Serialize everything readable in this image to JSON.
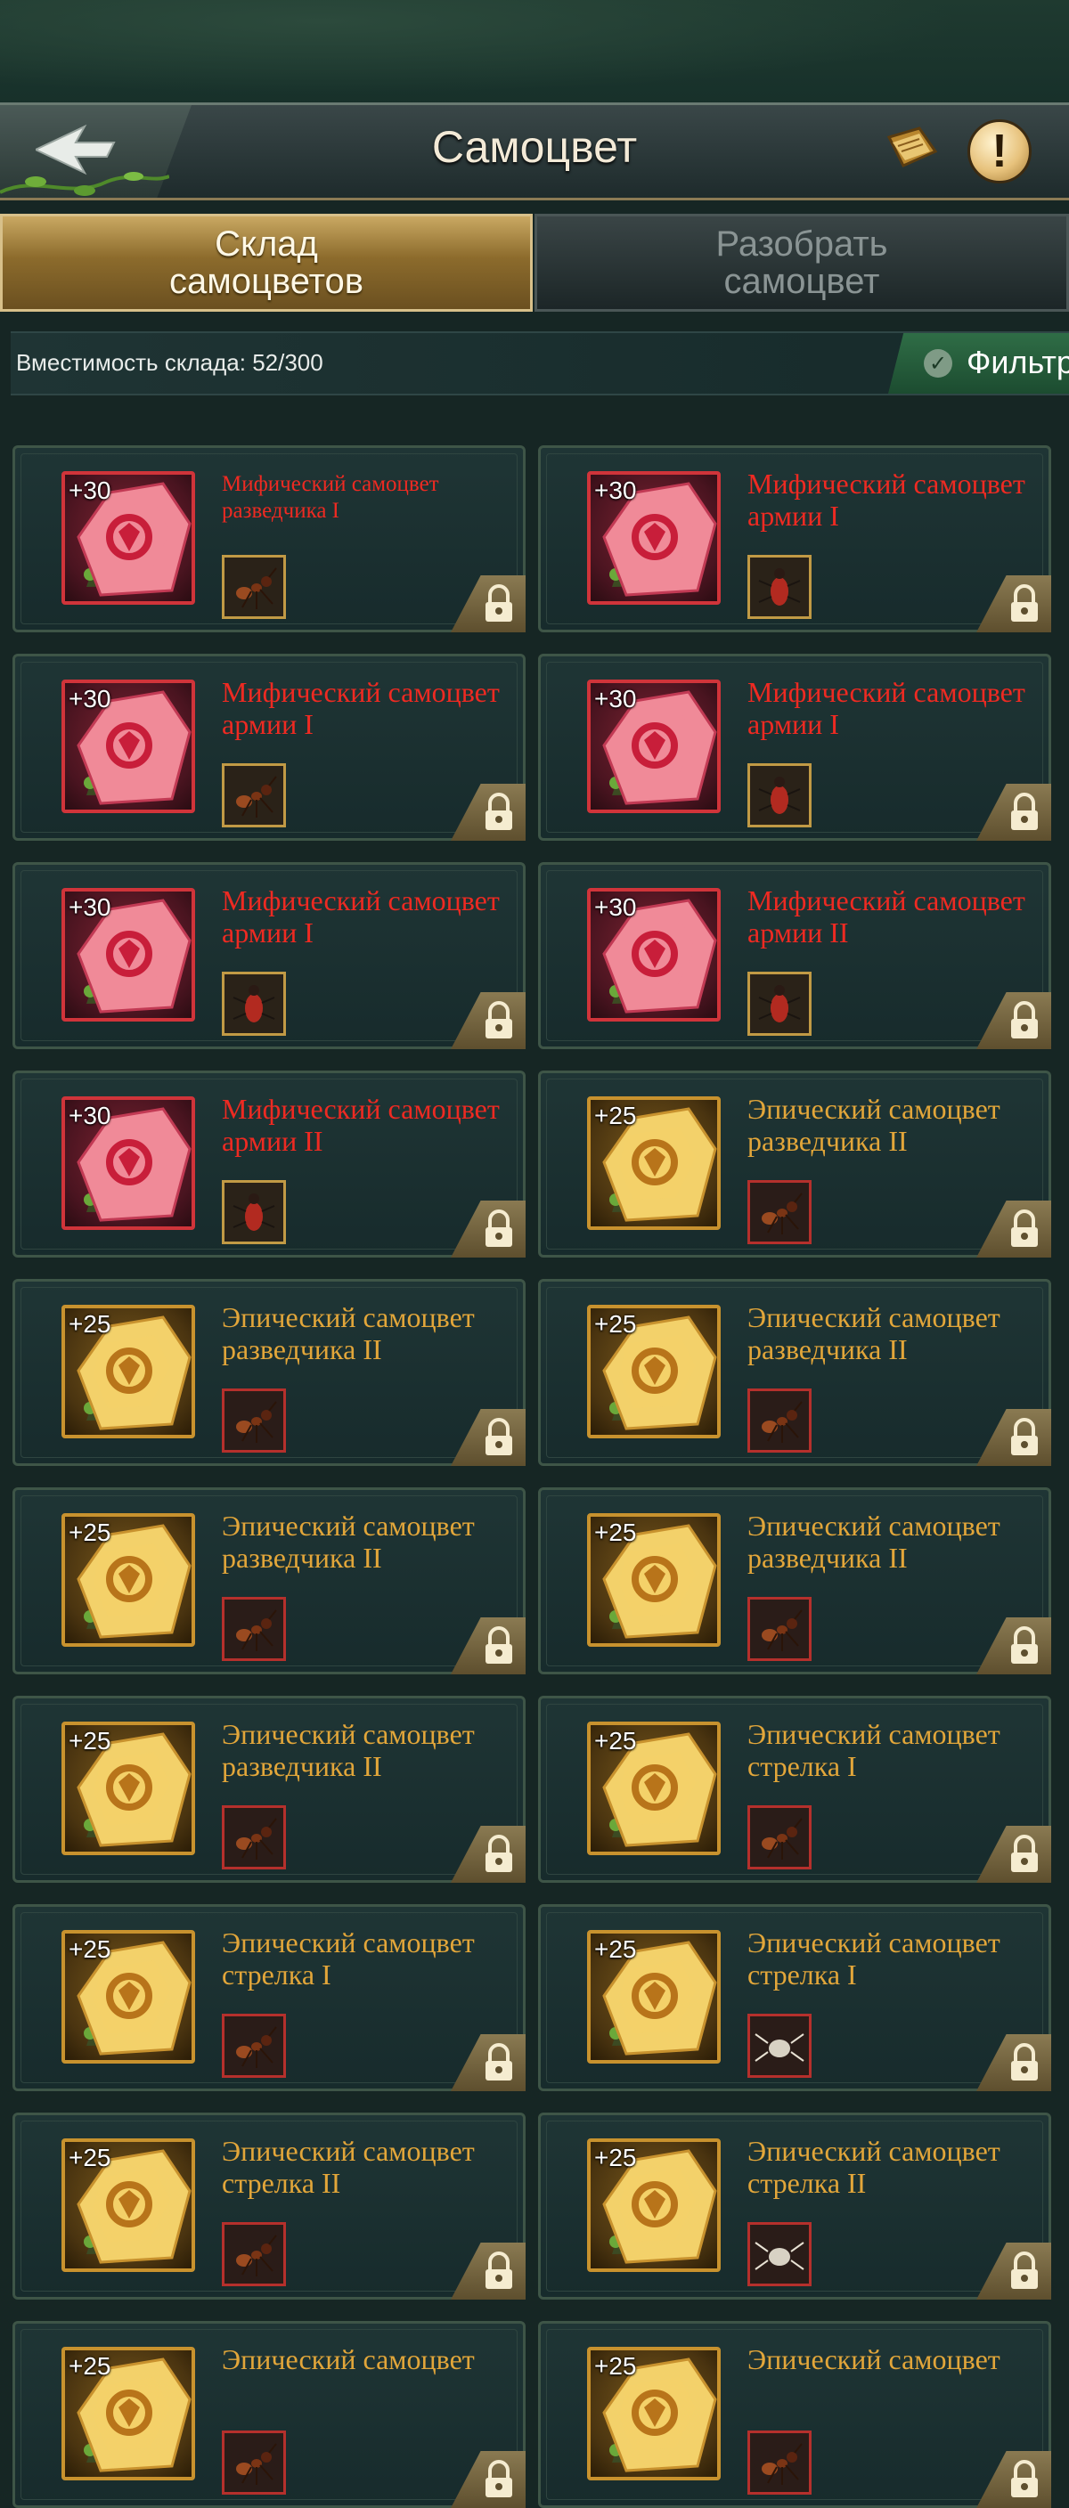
{
  "header": {
    "title": "Самоцвет",
    "back_icon": "back-arrow-icon",
    "book_icon": "book-icon",
    "info_icon": "exclamation-icon",
    "info_glyph": "!"
  },
  "tabs": [
    {
      "label": "Склад самоцветов",
      "active": true
    },
    {
      "label": "Разобрать самоцвет",
      "active": false
    }
  ],
  "storage": {
    "capacity_text": "Вместимость склада: 52/300",
    "filter_label": "Фильтр"
  },
  "colors": {
    "mythic": "#ee2a22",
    "epic": "#e2a63a"
  },
  "items": [
    {
      "bonus": "+30",
      "name": "Мифический самоцвет разведчика I",
      "rarity": "mythic",
      "unit_icon": "ant-icon",
      "locked": true
    },
    {
      "bonus": "+30",
      "name": "Мифический самоцвет армии I",
      "rarity": "mythic",
      "unit_icon": "beetle-icon",
      "locked": true
    },
    {
      "bonus": "+30",
      "name": "Мифический самоцвет армии I",
      "rarity": "mythic",
      "unit_icon": "ant-icon",
      "locked": true
    },
    {
      "bonus": "+30",
      "name": "Мифический самоцвет армии I",
      "rarity": "mythic",
      "unit_icon": "beetle-icon",
      "locked": true
    },
    {
      "bonus": "+30",
      "name": "Мифический самоцвет армии I",
      "rarity": "mythic",
      "unit_icon": "beetle-icon",
      "locked": true
    },
    {
      "bonus": "+30",
      "name": "Мифический самоцвет армии II",
      "rarity": "mythic",
      "unit_icon": "beetle-icon",
      "locked": true
    },
    {
      "bonus": "+30",
      "name": "Мифический самоцвет армии II",
      "rarity": "mythic",
      "unit_icon": "beetle-icon",
      "locked": true
    },
    {
      "bonus": "+25",
      "name": "Эпический самоцвет разведчика II",
      "rarity": "epic",
      "unit_icon": "ant-icon",
      "locked": true
    },
    {
      "bonus": "+25",
      "name": "Эпический самоцвет разведчика II",
      "rarity": "epic",
      "unit_icon": "ant-icon",
      "locked": true
    },
    {
      "bonus": "+25",
      "name": "Эпический самоцвет разведчика II",
      "rarity": "epic",
      "unit_icon": "ant-icon",
      "locked": true
    },
    {
      "bonus": "+25",
      "name": "Эпический самоцвет разведчика II",
      "rarity": "epic",
      "unit_icon": "ant-icon",
      "locked": true
    },
    {
      "bonus": "+25",
      "name": "Эпический самоцвет разведчика II",
      "rarity": "epic",
      "unit_icon": "ant-icon",
      "locked": true
    },
    {
      "bonus": "+25",
      "name": "Эпический самоцвет разведчика II",
      "rarity": "epic",
      "unit_icon": "ant-icon",
      "locked": true
    },
    {
      "bonus": "+25",
      "name": "Эпический самоцвет стрелка I",
      "rarity": "epic",
      "unit_icon": "ant-icon",
      "locked": true
    },
    {
      "bonus": "+25",
      "name": "Эпический самоцвет стрелка I",
      "rarity": "epic",
      "unit_icon": "ant-icon",
      "locked": true
    },
    {
      "bonus": "+25",
      "name": "Эпический самоцвет стрелка I",
      "rarity": "epic",
      "unit_icon": "spider-icon",
      "locked": true
    },
    {
      "bonus": "+25",
      "name": "Эпический самоцвет стрелка II",
      "rarity": "epic",
      "unit_icon": "ant-icon",
      "locked": true
    },
    {
      "bonus": "+25",
      "name": "Эпический самоцвет стрелка II",
      "rarity": "epic",
      "unit_icon": "spider-icon",
      "locked": true
    },
    {
      "bonus": "+25",
      "name": "Эпический самоцвет",
      "rarity": "epic",
      "unit_icon": "ant-icon",
      "locked": true
    },
    {
      "bonus": "+25",
      "name": "Эпический самоцвет",
      "rarity": "epic",
      "unit_icon": "ant-icon",
      "locked": true
    }
  ]
}
